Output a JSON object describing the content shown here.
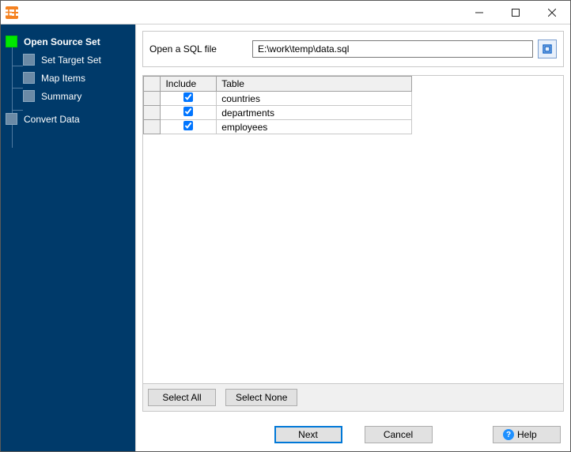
{
  "titlebar": {
    "title": ""
  },
  "wizard": {
    "steps": [
      {
        "label": "Open Source Set",
        "active": true,
        "children": [
          {
            "label": "Set Target Set"
          },
          {
            "label": "Map Items"
          },
          {
            "label": "Summary"
          }
        ]
      },
      {
        "label": "Convert Data",
        "active": false
      }
    ]
  },
  "form": {
    "open_label": "Open a SQL file",
    "path_value": "E:\\work\\temp\\data.sql"
  },
  "table": {
    "headers": {
      "include": "Include",
      "table": "Table"
    },
    "rows": [
      {
        "include": true,
        "name": "countries"
      },
      {
        "include": true,
        "name": "departments"
      },
      {
        "include": true,
        "name": "employees"
      }
    ]
  },
  "buttons": {
    "select_all": "Select All",
    "select_none": "Select None",
    "next": "Next",
    "cancel": "Cancel",
    "help": "Help"
  }
}
